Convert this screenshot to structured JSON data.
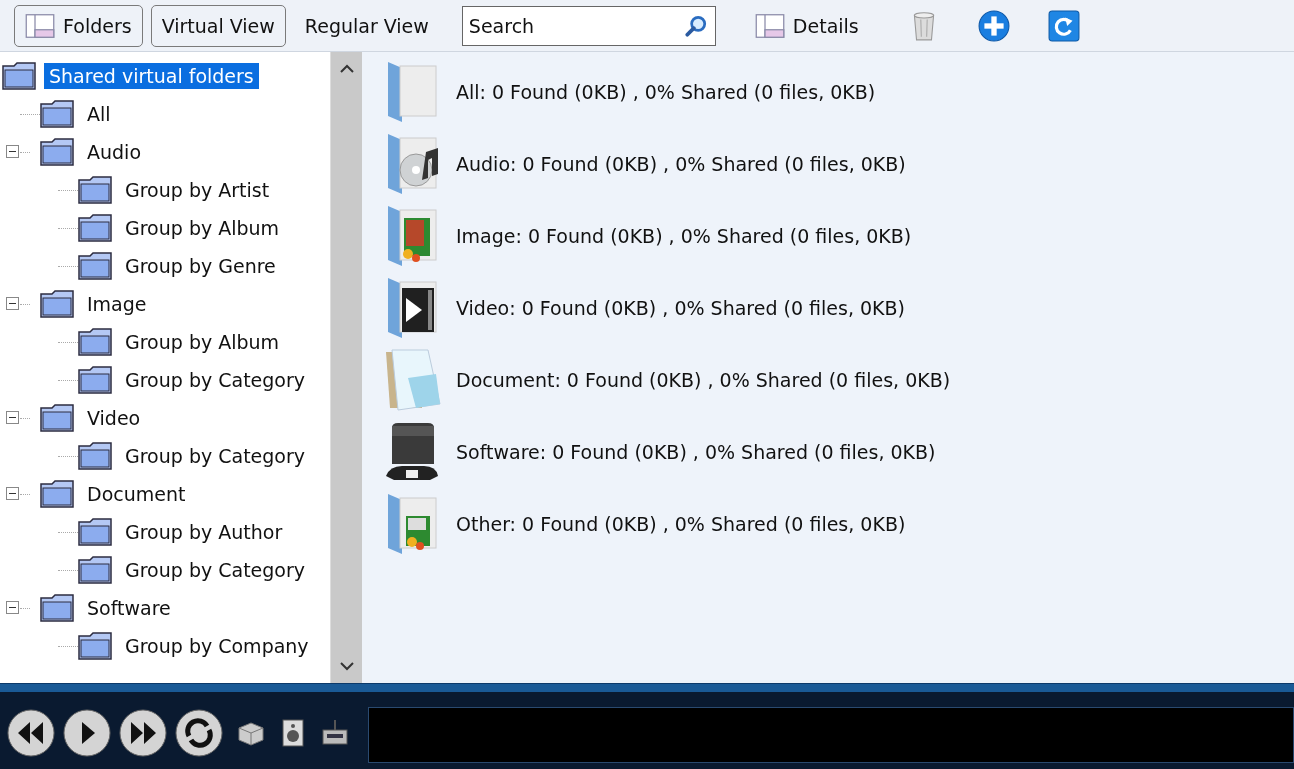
{
  "toolbar": {
    "folders_button": "Folders",
    "views": [
      {
        "label": "Virtual View",
        "selected": true
      },
      {
        "label": "Regular View",
        "selected": false
      }
    ],
    "search": {
      "placeholder": "Search"
    },
    "details_button": "Details"
  },
  "tree": {
    "label": "Shared virtual folders",
    "selected": true,
    "children": [
      {
        "label": "All",
        "selected": false
      },
      {
        "label": "Audio",
        "selected": false,
        "expanded": true,
        "children": [
          {
            "label": "Group by Artist",
            "selected": false
          },
          {
            "label": "Group by Album",
            "selected": false
          },
          {
            "label": "Group by Genre",
            "selected": false
          }
        ]
      },
      {
        "label": "Image",
        "selected": false,
        "expanded": true,
        "children": [
          {
            "label": "Group by Album",
            "selected": false
          },
          {
            "label": "Group by Category",
            "selected": false
          }
        ]
      },
      {
        "label": "Video",
        "selected": false,
        "expanded": true,
        "children": [
          {
            "label": "Group by Category",
            "selected": false
          }
        ]
      },
      {
        "label": "Document",
        "selected": false,
        "expanded": true,
        "children": [
          {
            "label": "Group by Author",
            "selected": false
          },
          {
            "label": "Group by Category",
            "selected": false
          }
        ]
      },
      {
        "label": "Software",
        "selected": false,
        "expanded": true,
        "children": [
          {
            "label": "Group by Company",
            "selected": false
          }
        ]
      }
    ]
  },
  "categories": [
    {
      "kind": "all",
      "text": "All: 0 Found (0KB) , 0% Shared (0 files, 0KB)"
    },
    {
      "kind": "audio",
      "text": "Audio: 0 Found (0KB) , 0% Shared (0 files, 0KB)"
    },
    {
      "kind": "image",
      "text": "Image: 0 Found (0KB) , 0% Shared (0 files, 0KB)"
    },
    {
      "kind": "video",
      "text": "Video: 0 Found (0KB) , 0% Shared (0 files, 0KB)"
    },
    {
      "kind": "document",
      "text": "Document: 0 Found (0KB) , 0% Shared (0 files, 0KB)"
    },
    {
      "kind": "software",
      "text": "Software: 0 Found (0KB) , 0% Shared (0 files, 0KB)"
    },
    {
      "kind": "other",
      "text": "Other: 0 Found (0KB) , 0% Shared (0 files, 0KB)"
    }
  ]
}
